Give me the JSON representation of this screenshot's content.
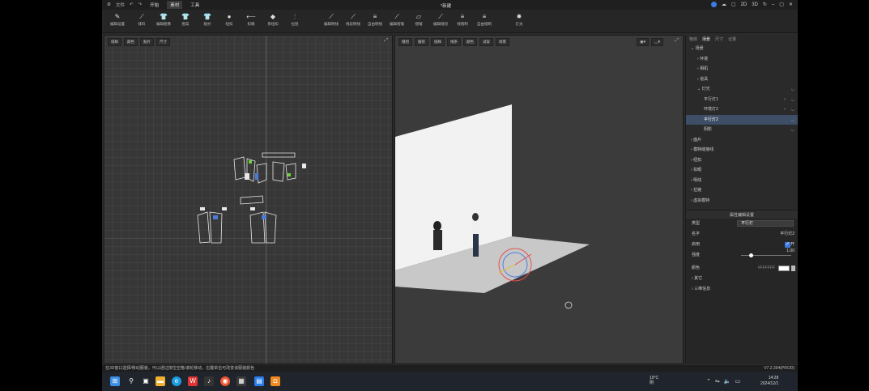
{
  "titlebar": {
    "app_menu": "文件",
    "tabs": [
      "开始",
      "素材",
      "工具"
    ],
    "active_tab": "素材",
    "doc_title": "*新建",
    "right_icons": [
      "2D",
      "3D"
    ]
  },
  "toolbar": {
    "tools": [
      "编辑设置",
      "排料",
      "编辑图像",
      "图案",
      "粘衬",
      "纽扣",
      "扣眼",
      "系纽扣",
      "拉链",
      "编辑明线",
      "线段明线",
      "自由明线",
      "编辑褶皱",
      "褶皱",
      "编辑缝纫",
      "线缝制",
      "自由缝制",
      "灯光"
    ]
  },
  "left_view": {
    "tools": [
      "纸样",
      "颜色",
      "贴片",
      "尺寸"
    ]
  },
  "right_view": {
    "tools": [
      "缝纫",
      "服装",
      "纸样",
      "线条",
      "颜色",
      "试穿",
      "场景"
    ]
  },
  "scene_panel": {
    "tabs": [
      "物体",
      "场景",
      "尺寸",
      "记录"
    ],
    "active_tab": "场景",
    "tree": [
      {
        "label": "场景",
        "level": 0,
        "expand": "open"
      },
      {
        "label": "环境",
        "level": 1,
        "expand": "closed"
      },
      {
        "label": "相机",
        "level": 1,
        "expand": "closed"
      },
      {
        "label": "道具",
        "level": 1,
        "expand": "closed"
      },
      {
        "label": "灯光",
        "level": 1,
        "expand": "open"
      },
      {
        "label": "平行灯1",
        "level": 2,
        "expand": ""
      },
      {
        "label": "环境灯2",
        "level": 2,
        "expand": ""
      },
      {
        "label": "平行灯2",
        "level": 2,
        "expand": "",
        "selected": true
      },
      {
        "label": "阴影",
        "level": 2,
        "expand": ""
      },
      {
        "label": "面片",
        "level": 0,
        "expand": "closed"
      },
      {
        "label": "模特缝接线",
        "level": 0,
        "expand": "closed"
      },
      {
        "label": "纽扣",
        "level": 0,
        "expand": "closed"
      },
      {
        "label": "扣眼",
        "level": 0,
        "expand": "closed"
      },
      {
        "label": "明线",
        "level": 0,
        "expand": "closed"
      },
      {
        "label": "拉链",
        "level": 0,
        "expand": "closed"
      },
      {
        "label": "虚拟模特",
        "level": 0,
        "expand": "closed"
      }
    ]
  },
  "prop_panel": {
    "title": "属性编辑设置",
    "type_label": "类型",
    "type_value": "平行灯",
    "name_label": "名字",
    "name_value": "平行灯2",
    "enable_label": "启用",
    "enable_value": "开",
    "intensity_label": "强度",
    "intensity_value": "1.00",
    "intensity_level": 0.2,
    "color_label": "颜色",
    "color_value": "#FFFFFF",
    "other_label": "其它",
    "transform_label": "三维信息"
  },
  "statusbar": {
    "hint": "在3D窗口选择/移动服装，可以通过按住空格/滚轮移动，右键单击可改变该服装颜色",
    "version": "V7.2.394(PROD)"
  },
  "taskbar": {
    "weather_temp": "19°C",
    "weather_desc": "阴",
    "time": "14:28",
    "date": "2024/12/1"
  }
}
